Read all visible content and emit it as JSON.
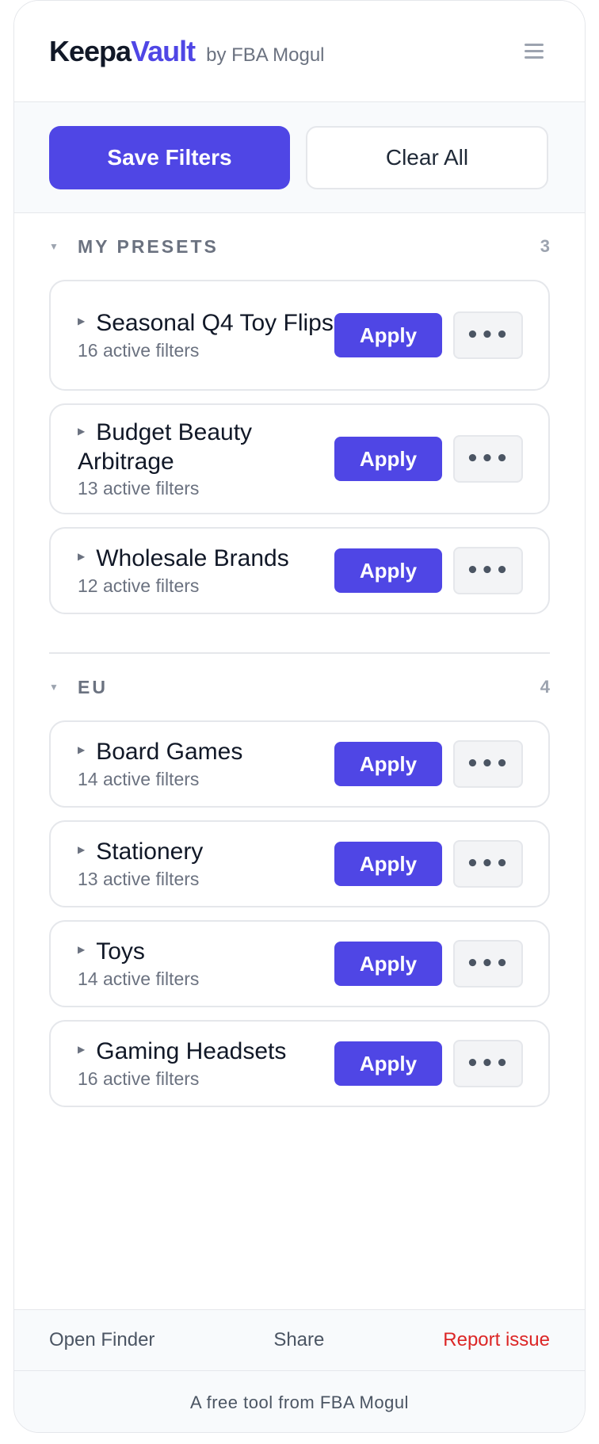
{
  "header": {
    "brand_part1": "Keepa",
    "brand_part2": "Vault",
    "brand_by": "by FBA Mogul",
    "menu_icon": "hamburger-menu-icon"
  },
  "toolbar": {
    "save_label": "Save Filters",
    "clear_label": "Clear All"
  },
  "sections": [
    {
      "title": "MY PRESETS",
      "count": "3",
      "presets": [
        {
          "name": "Seasonal Q4 Toy Flips",
          "filters": "16 active filters",
          "apply": "Apply",
          "more": "•••"
        },
        {
          "name": "Budget Beauty Arbitrage",
          "filters": "13 active filters",
          "apply": "Apply",
          "more": "•••"
        },
        {
          "name": "Wholesale Brands",
          "filters": "12 active filters",
          "apply": "Apply",
          "more": "•••"
        }
      ]
    },
    {
      "title": "EU",
      "count": "4",
      "presets": [
        {
          "name": "Board Games",
          "filters": "14 active filters",
          "apply": "Apply",
          "more": "•••"
        },
        {
          "name": "Stationery",
          "filters": "13 active filters",
          "apply": "Apply",
          "more": "•••"
        },
        {
          "name": "Toys",
          "filters": "14 active filters",
          "apply": "Apply",
          "more": "•••"
        },
        {
          "name": "Gaming Headsets",
          "filters": "16 active filters",
          "apply": "Apply",
          "more": "•••"
        }
      ]
    }
  ],
  "footer": {
    "open_finder": "Open Finder",
    "share": "Share",
    "report": "Report issue",
    "note": "A free tool from FBA Mogul"
  },
  "colors": {
    "accent": "#4f46e5",
    "danger": "#dc2626",
    "muted": "#6b7280"
  }
}
